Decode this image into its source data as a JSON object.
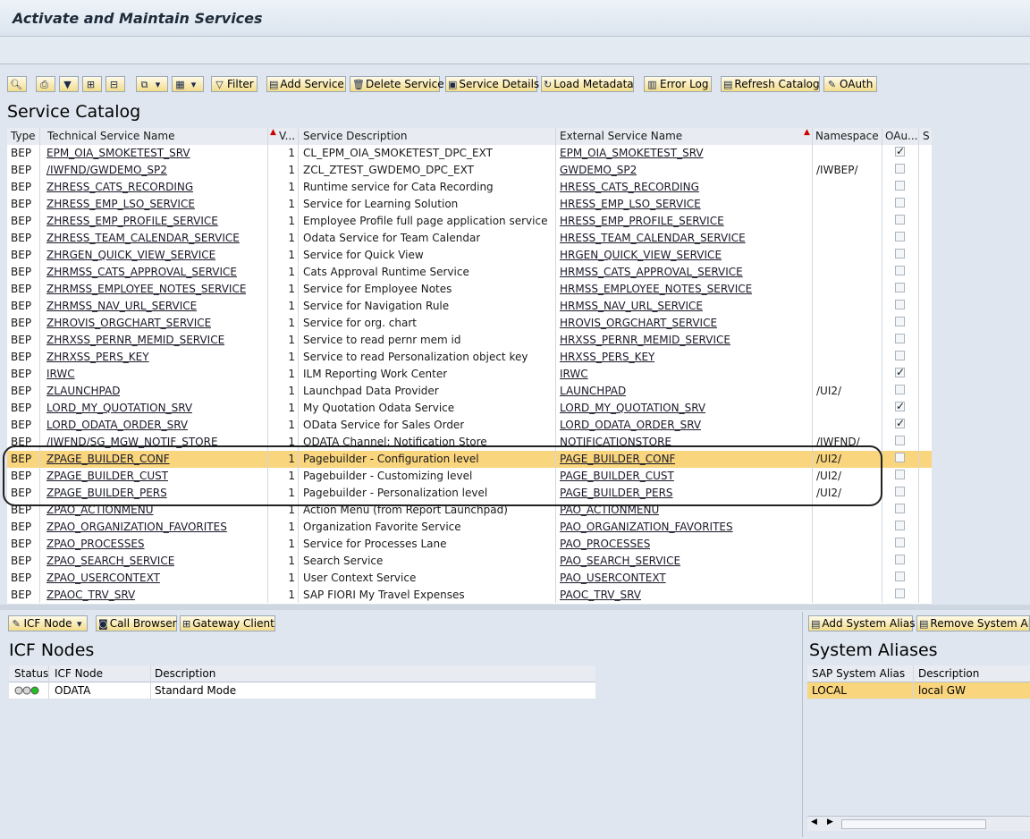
{
  "window": {
    "title": "Activate and Maintain Services"
  },
  "toolbar": {
    "filter": "Filter",
    "add_service": "Add Service",
    "delete_service": "Delete Service",
    "service_details": "Service Details",
    "load_metadata": "Load Metadata",
    "error_log": "Error Log",
    "refresh_catalog": "Refresh Catalog",
    "oauth": "OAuth"
  },
  "catalog": {
    "title": "Service Catalog",
    "columns": [
      "Type",
      "Technical Service Name",
      "V...",
      "Service Description",
      "External Service Name",
      "Namespace",
      "OAu...",
      "S"
    ],
    "rows": [
      {
        "type": "BEP",
        "tech": "EPM_OIA_SMOKETEST_SRV",
        "v": "1",
        "desc": "CL_EPM_OIA_SMOKETEST_DPC_EXT",
        "ext": "EPM_OIA_SMOKETEST_SRV",
        "ns": "",
        "oauth": true
      },
      {
        "type": "BEP",
        "tech": "/IWFND/GWDEMO_SP2",
        "v": "1",
        "desc": "ZCL_ZTEST_GWDEMO_DPC_EXT",
        "ext": "GWDEMO_SP2",
        "ns": "/IWBEP/",
        "oauth": false
      },
      {
        "type": "BEP",
        "tech": "ZHRESS_CATS_RECORDING",
        "v": "1",
        "desc": "Runtime service for Cata Recording",
        "ext": "HRESS_CATS_RECORDING",
        "ns": "",
        "oauth": false
      },
      {
        "type": "BEP",
        "tech": "ZHRESS_EMP_LSO_SERVICE",
        "v": "1",
        "desc": "Service for Learning Solution",
        "ext": "HRESS_EMP_LSO_SERVICE",
        "ns": "",
        "oauth": false
      },
      {
        "type": "BEP",
        "tech": "ZHRESS_EMP_PROFILE_SERVICE",
        "v": "1",
        "desc": "Employee Profile full page application service",
        "ext": "HRESS_EMP_PROFILE_SERVICE",
        "ns": "",
        "oauth": false
      },
      {
        "type": "BEP",
        "tech": "ZHRESS_TEAM_CALENDAR_SERVICE",
        "v": "1",
        "desc": "Odata Service for Team Calendar",
        "ext": "HRESS_TEAM_CALENDAR_SERVICE",
        "ns": "",
        "oauth": false
      },
      {
        "type": "BEP",
        "tech": "ZHRGEN_QUICK_VIEW_SERVICE",
        "v": "1",
        "desc": "Service for Quick View",
        "ext": "HRGEN_QUICK_VIEW_SERVICE",
        "ns": "",
        "oauth": false
      },
      {
        "type": "BEP",
        "tech": "ZHRMSS_CATS_APPROVAL_SERVICE",
        "v": "1",
        "desc": "Cats Approval Runtime Service",
        "ext": "HRMSS_CATS_APPROVAL_SERVICE",
        "ns": "",
        "oauth": false
      },
      {
        "type": "BEP",
        "tech": "ZHRMSS_EMPLOYEE_NOTES_SERVICE",
        "v": "1",
        "desc": "Service for Employee Notes",
        "ext": "HRMSS_EMPLOYEE_NOTES_SERVICE",
        "ns": "",
        "oauth": false
      },
      {
        "type": "BEP",
        "tech": "ZHRMSS_NAV_URL_SERVICE",
        "v": "1",
        "desc": "Service for Navigation Rule",
        "ext": "HRMSS_NAV_URL_SERVICE",
        "ns": "",
        "oauth": false
      },
      {
        "type": "BEP",
        "tech": "ZHROVIS_ORGCHART_SERVICE",
        "v": "1",
        "desc": "Service for org. chart",
        "ext": "HROVIS_ORGCHART_SERVICE",
        "ns": "",
        "oauth": false
      },
      {
        "type": "BEP",
        "tech": "ZHRXSS_PERNR_MEMID_SERVICE",
        "v": "1",
        "desc": "Service to read pernr mem id",
        "ext": "HRXSS_PERNR_MEMID_SERVICE",
        "ns": "",
        "oauth": false
      },
      {
        "type": "BEP",
        "tech": "ZHRXSS_PERS_KEY",
        "v": "1",
        "desc": "Service to read Personalization object key",
        "ext": "HRXSS_PERS_KEY",
        "ns": "",
        "oauth": false
      },
      {
        "type": "BEP",
        "tech": "IRWC",
        "v": "1",
        "desc": "ILM Reporting Work Center",
        "ext": "IRWC",
        "ns": "",
        "oauth": true
      },
      {
        "type": "BEP",
        "tech": "ZLAUNCHPAD",
        "v": "1",
        "desc": "Launchpad Data Provider",
        "ext": "LAUNCHPAD",
        "ns": "/UI2/",
        "oauth": false
      },
      {
        "type": "BEP",
        "tech": "LORD_MY_QUOTATION_SRV",
        "v": "1",
        "desc": "My Quotation Odata Service",
        "ext": "LORD_MY_QUOTATION_SRV",
        "ns": "",
        "oauth": true
      },
      {
        "type": "BEP",
        "tech": "LORD_ODATA_ORDER_SRV",
        "v": "1",
        "desc": "OData Service for Sales Order",
        "ext": "LORD_ODATA_ORDER_SRV",
        "ns": "",
        "oauth": true
      },
      {
        "type": "BEP",
        "tech": "/IWFND/SG_MGW_NOTIF_STORE",
        "v": "1",
        "desc": "ODATA Channel: Notification Store",
        "ext": "NOTIFICATIONSTORE",
        "ns": "/IWFND/",
        "oauth": false
      },
      {
        "type": "BEP",
        "tech": "ZPAGE_BUILDER_CONF",
        "v": "1",
        "desc": "Pagebuilder - Configuration level",
        "ext": "PAGE_BUILDER_CONF",
        "ns": "/UI2/",
        "oauth": false,
        "selected": true
      },
      {
        "type": "BEP",
        "tech": "ZPAGE_BUILDER_CUST",
        "v": "1",
        "desc": "Pagebuilder - Customizing level",
        "ext": "PAGE_BUILDER_CUST",
        "ns": "/UI2/",
        "oauth": false
      },
      {
        "type": "BEP",
        "tech": "ZPAGE_BUILDER_PERS",
        "v": "1",
        "desc": "Pagebuilder - Personalization level",
        "ext": "PAGE_BUILDER_PERS",
        "ns": "/UI2/",
        "oauth": false
      },
      {
        "type": "BEP",
        "tech": "ZPAO_ACTIONMENU",
        "v": "1",
        "desc": "Action Menu (from Report Launchpad)",
        "ext": "PAO_ACTIONMENU",
        "ns": "",
        "oauth": false
      },
      {
        "type": "BEP",
        "tech": "ZPAO_ORGANIZATION_FAVORITES",
        "v": "1",
        "desc": "Organization Favorite Service",
        "ext": "PAO_ORGANIZATION_FAVORITES",
        "ns": "",
        "oauth": false
      },
      {
        "type": "BEP",
        "tech": "ZPAO_PROCESSES",
        "v": "1",
        "desc": "Service for Processes Lane",
        "ext": "PAO_PROCESSES",
        "ns": "",
        "oauth": false
      },
      {
        "type": "BEP",
        "tech": "ZPAO_SEARCH_SERVICE",
        "v": "1",
        "desc": "Search Service",
        "ext": "PAO_SEARCH_SERVICE",
        "ns": "",
        "oauth": false
      },
      {
        "type": "BEP",
        "tech": "ZPAO_USERCONTEXT",
        "v": "1",
        "desc": "User Context Service",
        "ext": "PAO_USERCONTEXT",
        "ns": "",
        "oauth": false
      },
      {
        "type": "BEP",
        "tech": "ZPAOC_TRV_SRV",
        "v": "1",
        "desc": "SAP FIORI My Travel Expenses",
        "ext": "PAOC_TRV_SRV",
        "ns": "",
        "oauth": false
      }
    ]
  },
  "icf": {
    "toolbar": {
      "icf_node": "ICF Node",
      "call_browser": "Call Browser",
      "gateway_client": "Gateway Client"
    },
    "title": "ICF Nodes",
    "columns": [
      "Status",
      "ICF Node",
      "Description"
    ],
    "rows": [
      {
        "node": "ODATA",
        "desc": "Standard Mode"
      }
    ]
  },
  "aliases": {
    "toolbar": {
      "add": "Add System Alias",
      "remove": "Remove System Alias"
    },
    "title": "System Aliases",
    "columns": [
      "SAP System Alias",
      "Description"
    ],
    "rows": [
      {
        "alias": "LOCAL",
        "desc": "local GW"
      }
    ]
  }
}
